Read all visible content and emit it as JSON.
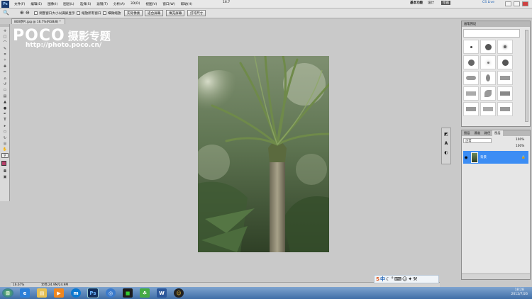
{
  "menubar": {
    "items": [
      "文件(F)",
      "编辑(E)",
      "图像(I)",
      "图层(L)",
      "选择(S)",
      "滤镜(T)",
      "分析(A)",
      "3D(D)",
      "视图(V)",
      "窗口(W)",
      "帮助(H)"
    ],
    "zoom": "16.7",
    "workspaces": [
      "基本功能",
      "设计",
      "绘画"
    ],
    "cs_live": "CS Live"
  },
  "options": {
    "resize_windows": "调整窗口大小以满屏显示",
    "zoom_all": "缩放所有窗口",
    "scrubby_zoom": "细微缩放",
    "actual_pixels": "实际像素",
    "fit_screen": "适合屏幕",
    "fill_screen": "填充屏幕",
    "print_size": "打印尺寸"
  },
  "document": {
    "tab": "800原片.jpg @ 16.7%(RGB/8) *",
    "zoom": "16.67%",
    "doc_size": "文档:24.9M/24.9M"
  },
  "watermark": {
    "poco": "POCO",
    "cn": "摄影专题",
    "url": "http://photo.poco.cn/"
  },
  "brushes_panel": {
    "title": "画笔预设"
  },
  "layers_panel": {
    "tabs": [
      "图层",
      "通道",
      "路径"
    ],
    "blend_mode": "正常",
    "opacity": "100%",
    "fill": "100%",
    "layer_name": "背景"
  },
  "taskbar": {
    "time": "18:28",
    "date": "2012/7/26"
  },
  "colors": {
    "accent": "#3c8df4",
    "foreground_swatch": "#b8406a"
  }
}
